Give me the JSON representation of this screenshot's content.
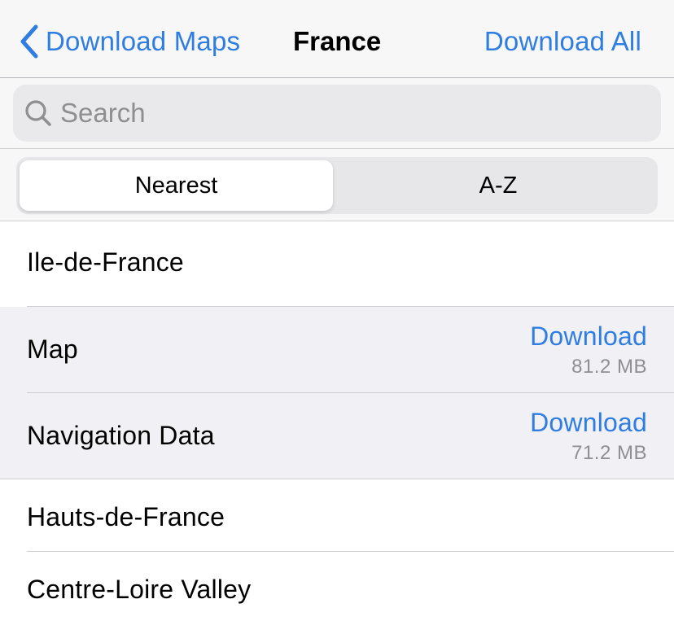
{
  "nav": {
    "back_label": "Download Maps",
    "title": "France",
    "action_label": "Download All"
  },
  "search": {
    "placeholder": "Search",
    "value": ""
  },
  "segment": {
    "options": [
      "Nearest",
      "A-Z"
    ],
    "selected": "Nearest"
  },
  "list": {
    "regions": [
      {
        "name": "Ile-de-France",
        "expanded": true,
        "items": [
          {
            "label": "Map",
            "action": "Download",
            "size": "81.2 MB"
          },
          {
            "label": "Navigation Data",
            "action": "Download",
            "size": "71.2 MB"
          }
        ]
      },
      {
        "name": "Hauts-de-France"
      },
      {
        "name": "Centre-Loire Valley"
      }
    ]
  },
  "colors": {
    "accent": "#2f7de1",
    "secondary_text": "#8e8e93",
    "bar_background": "#f7f7f8",
    "expanded_background": "#f1f1f5"
  }
}
